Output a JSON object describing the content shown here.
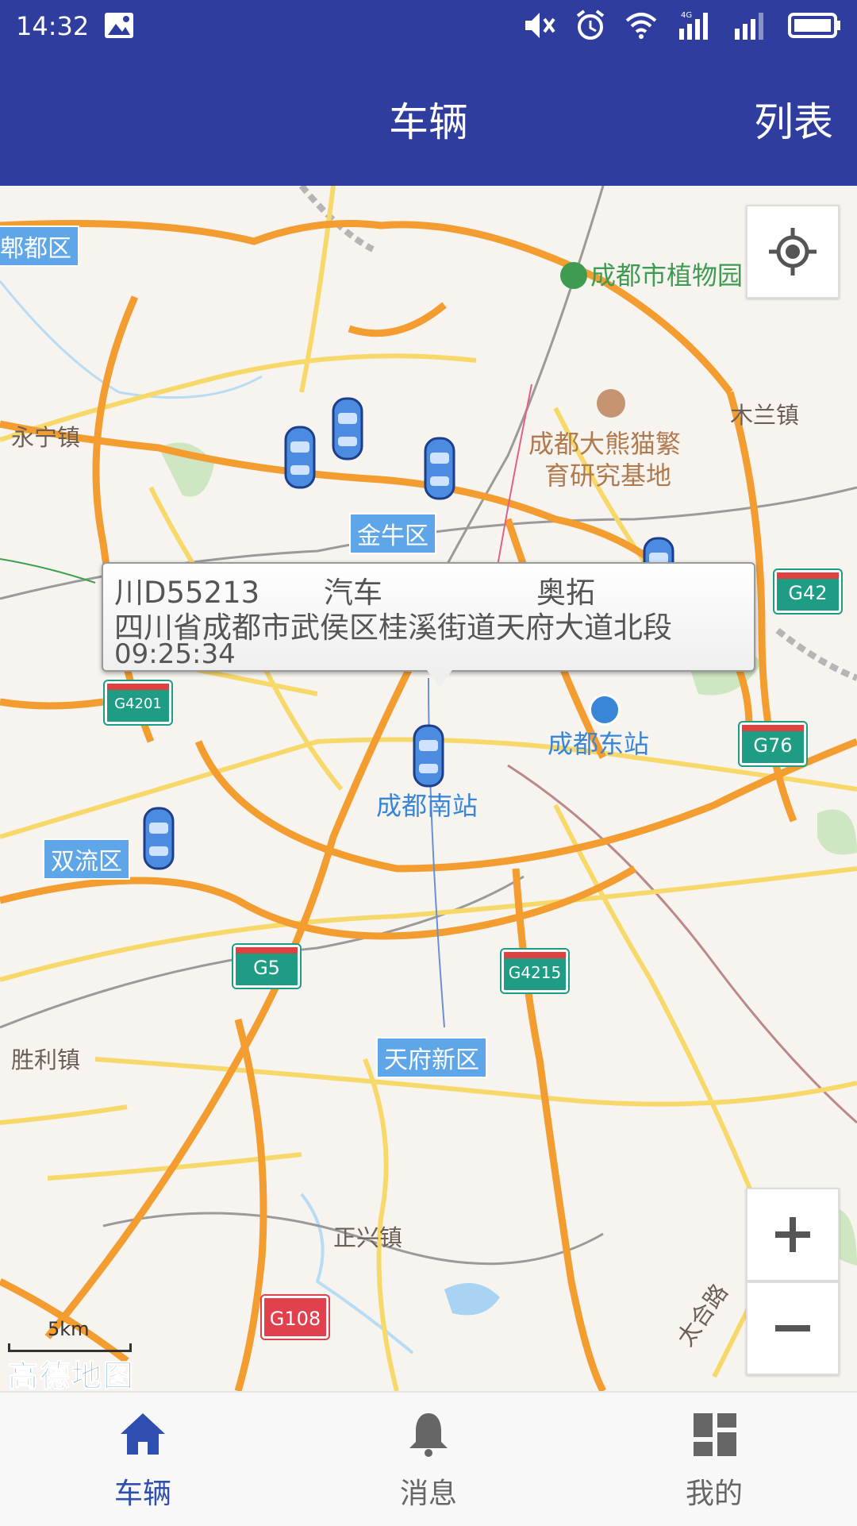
{
  "status_bar": {
    "time": "14:32"
  },
  "app_bar": {
    "title": "车辆",
    "action": "列表"
  },
  "map": {
    "labels": {
      "pidu": "郫都区",
      "yongning": "永宁镇",
      "botanical": "成都市植物园",
      "mulan": "木兰镇",
      "panda_line1": "成都大熊猫繁",
      "panda_line2": "育研究基地",
      "jinniu": "金牛区",
      "shuangliu": "双流区",
      "east_station": "成都东站",
      "south_station": "成都南站",
      "shengli": "胜利镇",
      "tianfu": "天府新区",
      "zhengxing": "正兴镇",
      "taihe": "太合路"
    },
    "shields": {
      "g42": "G42",
      "g4201": "G4201",
      "g76": "G76",
      "g5": "G5",
      "g4215": "G4215",
      "g108": "G108"
    },
    "scale": "5km",
    "logo": "高德地图"
  },
  "popup": {
    "plate": "川D55213",
    "type": "汽车",
    "model": "奥拓",
    "address": "四川省成都市武侯区桂溪街道天府大道北段",
    "time": "09:25:34"
  },
  "controls": {
    "zoom_in": "+",
    "zoom_out": "−"
  },
  "nav": {
    "items": [
      {
        "label": "车辆",
        "icon": "home-icon",
        "active": true
      },
      {
        "label": "消息",
        "icon": "bell-icon",
        "active": false
      },
      {
        "label": "我的",
        "icon": "dashboard-icon",
        "active": false
      }
    ]
  },
  "colors": {
    "primary": "#2f3e9e",
    "nav_active": "#2f4fb0",
    "map_bg": "#f7f4ef"
  }
}
